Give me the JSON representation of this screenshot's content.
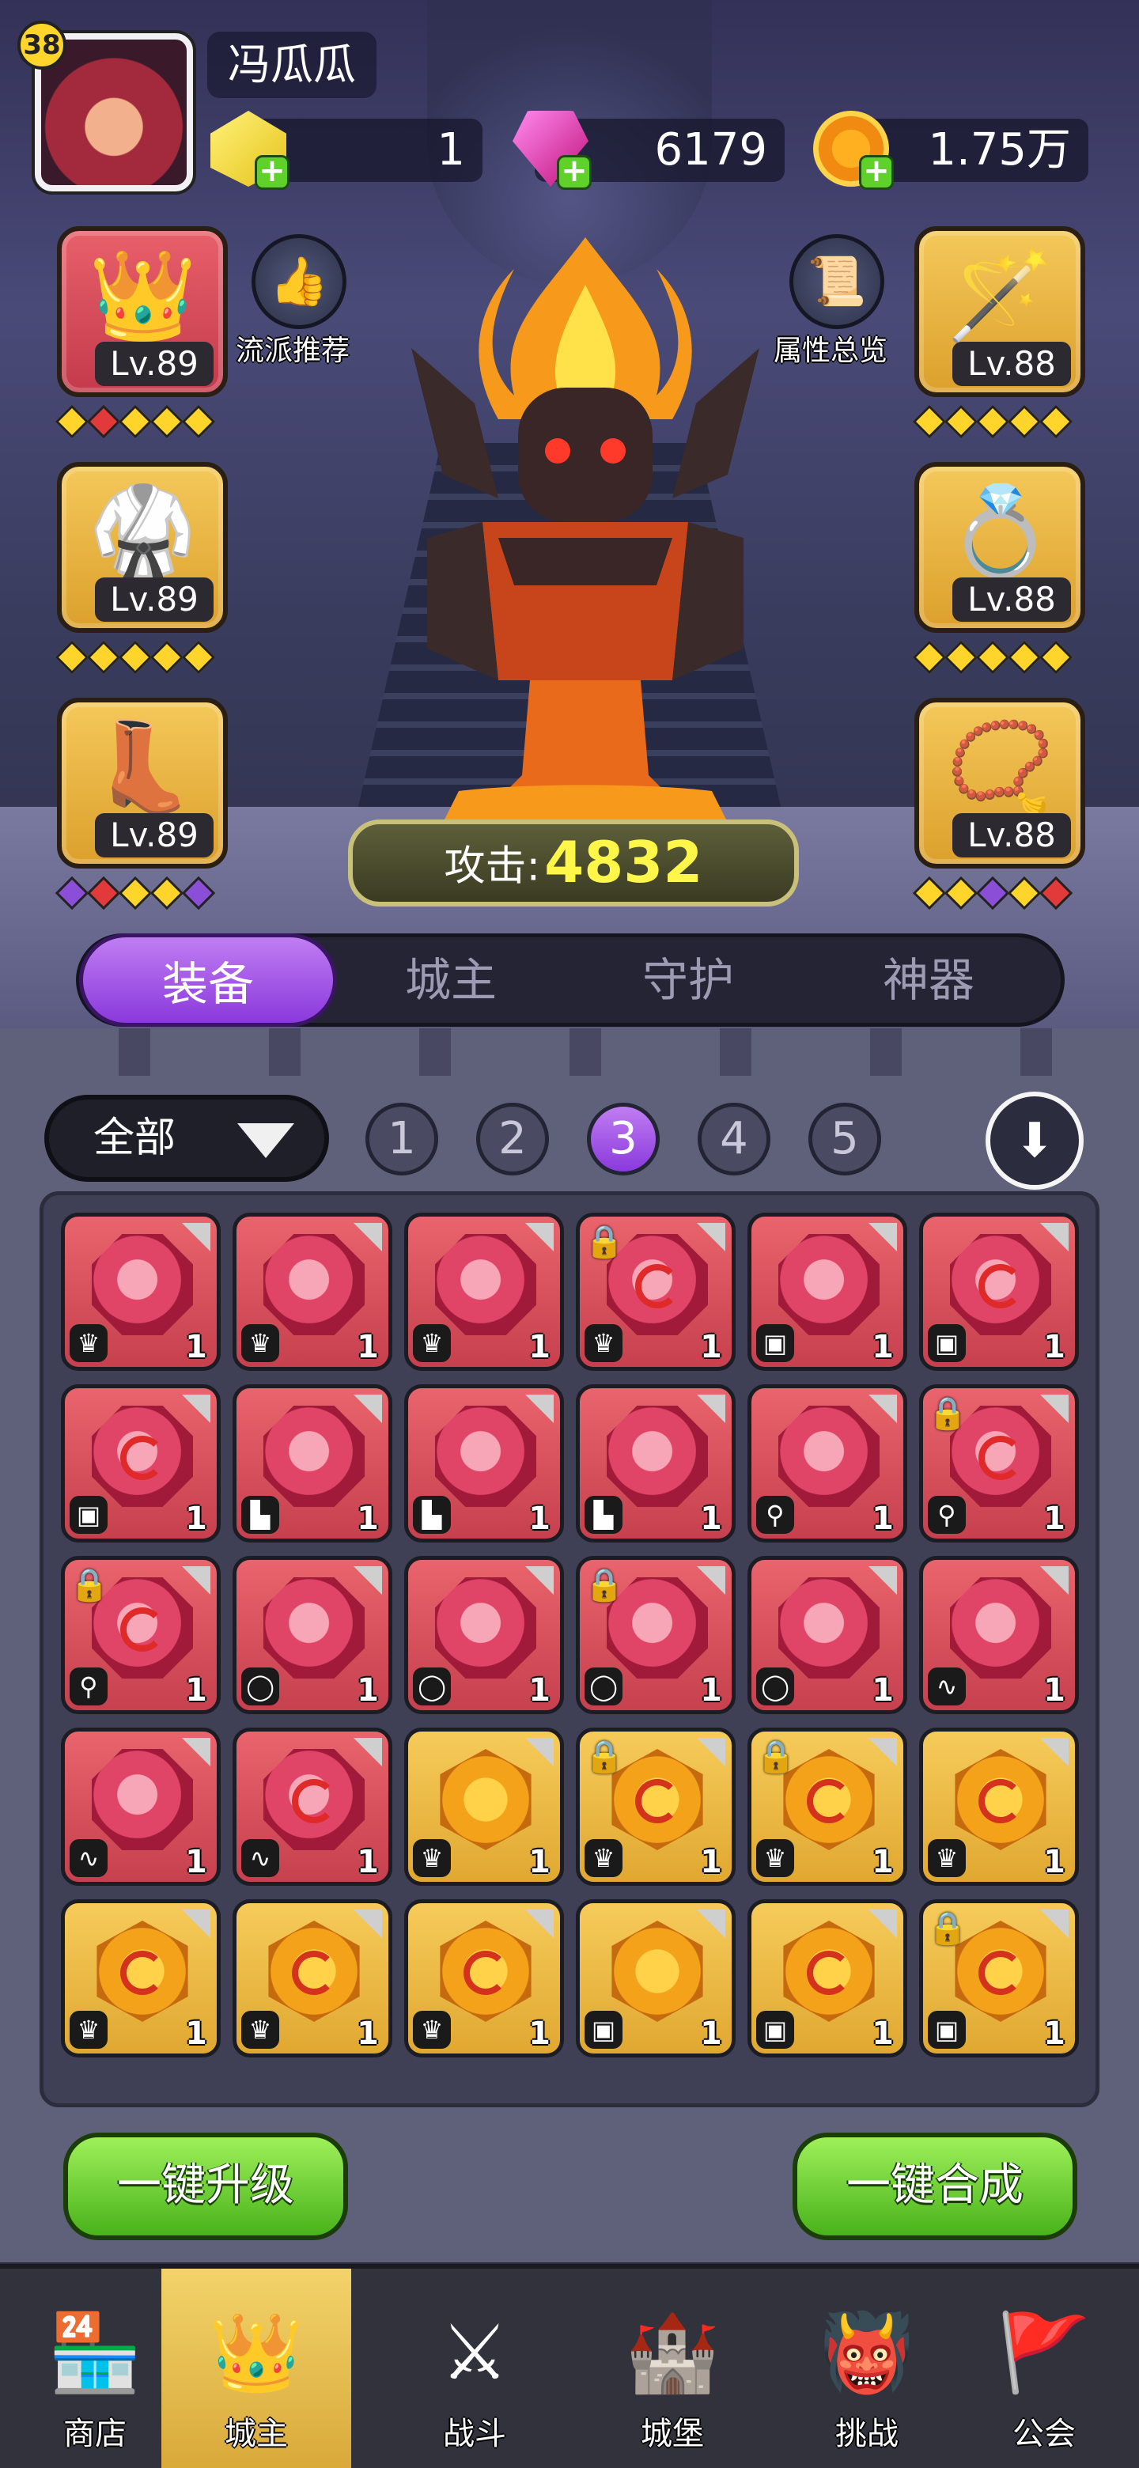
{
  "player": {
    "level": "38",
    "name": "冯瓜瓜"
  },
  "currencies": [
    {
      "icon": "yellow-gem-icon",
      "value": "1"
    },
    {
      "icon": "pink-crystal-icon",
      "value": "6179"
    },
    {
      "icon": "gold-coin-icon",
      "value": "1.75万"
    }
  ],
  "side_buttons": {
    "left_label": "流派推荐",
    "right_label": "属性总览"
  },
  "equipment": {
    "left": [
      {
        "name": "crown",
        "level": "Lv.89"
      },
      {
        "name": "armor",
        "level": "Lv.89"
      },
      {
        "name": "boots",
        "level": "Lv.89"
      }
    ],
    "right": [
      {
        "name": "staff",
        "level": "Lv.88"
      },
      {
        "name": "ring",
        "level": "Lv.88"
      },
      {
        "name": "amulet",
        "level": "Lv.88"
      }
    ]
  },
  "attack": {
    "label": "攻击:",
    "value": "4832"
  },
  "tabs": [
    "装备",
    "城主",
    "守护",
    "神器"
  ],
  "filter": {
    "selected": "全部"
  },
  "star_filters": [
    "1",
    "2",
    "3",
    "4",
    "5"
  ],
  "selected_star": "3",
  "inventory": [
    {
      "color": "red",
      "swirl": false,
      "lock": false,
      "type": "crown",
      "qty": "1"
    },
    {
      "color": "red",
      "swirl": false,
      "lock": false,
      "type": "crown",
      "qty": "1"
    },
    {
      "color": "red",
      "swirl": false,
      "lock": false,
      "type": "crown",
      "qty": "1"
    },
    {
      "color": "red",
      "swirl": true,
      "lock": true,
      "type": "crown",
      "qty": "1"
    },
    {
      "color": "red",
      "swirl": false,
      "lock": false,
      "type": "armor",
      "qty": "1"
    },
    {
      "color": "red",
      "swirl": true,
      "lock": false,
      "type": "armor",
      "qty": "1"
    },
    {
      "color": "red",
      "swirl": true,
      "lock": false,
      "type": "armor",
      "qty": "1"
    },
    {
      "color": "red",
      "swirl": false,
      "lock": false,
      "type": "boots",
      "qty": "1"
    },
    {
      "color": "red",
      "swirl": false,
      "lock": false,
      "type": "boots",
      "qty": "1"
    },
    {
      "color": "red",
      "swirl": false,
      "lock": false,
      "type": "boots",
      "qty": "1"
    },
    {
      "color": "red",
      "swirl": false,
      "lock": false,
      "type": "staff",
      "qty": "1"
    },
    {
      "color": "red",
      "swirl": true,
      "lock": true,
      "type": "staff",
      "qty": "1"
    },
    {
      "color": "red",
      "swirl": true,
      "lock": true,
      "type": "staff",
      "qty": "1"
    },
    {
      "color": "red",
      "swirl": false,
      "lock": false,
      "type": "ring",
      "qty": "1"
    },
    {
      "color": "red",
      "swirl": false,
      "lock": false,
      "type": "ring",
      "qty": "1"
    },
    {
      "color": "red",
      "swirl": false,
      "lock": true,
      "type": "ring",
      "qty": "1"
    },
    {
      "color": "red",
      "swirl": false,
      "lock": false,
      "type": "ring",
      "qty": "1"
    },
    {
      "color": "red",
      "swirl": false,
      "lock": false,
      "type": "amulet",
      "qty": "1"
    },
    {
      "color": "red",
      "swirl": false,
      "lock": false,
      "type": "amulet",
      "qty": "1"
    },
    {
      "color": "red",
      "swirl": true,
      "lock": false,
      "type": "amulet",
      "qty": "1"
    },
    {
      "color": "yellow",
      "swirl": false,
      "lock": false,
      "type": "crown",
      "qty": "1"
    },
    {
      "color": "yellow",
      "swirl": true,
      "lock": true,
      "type": "crown",
      "qty": "1"
    },
    {
      "color": "yellow",
      "swirl": true,
      "lock": true,
      "type": "crown",
      "qty": "1"
    },
    {
      "color": "yellow",
      "swirl": true,
      "lock": false,
      "type": "crown",
      "qty": "1"
    },
    {
      "color": "yellow",
      "swirl": true,
      "lock": false,
      "type": "crown",
      "qty": "1"
    },
    {
      "color": "yellow",
      "swirl": true,
      "lock": false,
      "type": "crown",
      "qty": "1"
    },
    {
      "color": "yellow",
      "swirl": true,
      "lock": false,
      "type": "crown",
      "qty": "1"
    },
    {
      "color": "yellow",
      "swirl": false,
      "lock": false,
      "type": "armor",
      "qty": "1"
    },
    {
      "color": "yellow",
      "swirl": true,
      "lock": false,
      "type": "armor",
      "qty": "1"
    },
    {
      "color": "yellow",
      "swirl": true,
      "lock": true,
      "type": "armor",
      "qty": "1"
    }
  ],
  "actions": {
    "upgrade_all": "一键升级",
    "combine_all": "一键合成"
  },
  "nav": [
    {
      "label": "商店",
      "icon": "shop-icon"
    },
    {
      "label": "城主",
      "icon": "crown-icon"
    },
    {
      "label": "战斗",
      "icon": "crossed-swords-icon"
    },
    {
      "label": "城堡",
      "icon": "castle-icon"
    },
    {
      "label": "挑战",
      "icon": "demon-helmet-icon"
    },
    {
      "label": "公会",
      "icon": "guild-banner-icon"
    }
  ],
  "nav_active": "城主",
  "colors": {
    "accent": "#8a39dc",
    "red_item": "#c6404e",
    "gold_item": "#e0a831",
    "action_green": "#49b21a"
  }
}
